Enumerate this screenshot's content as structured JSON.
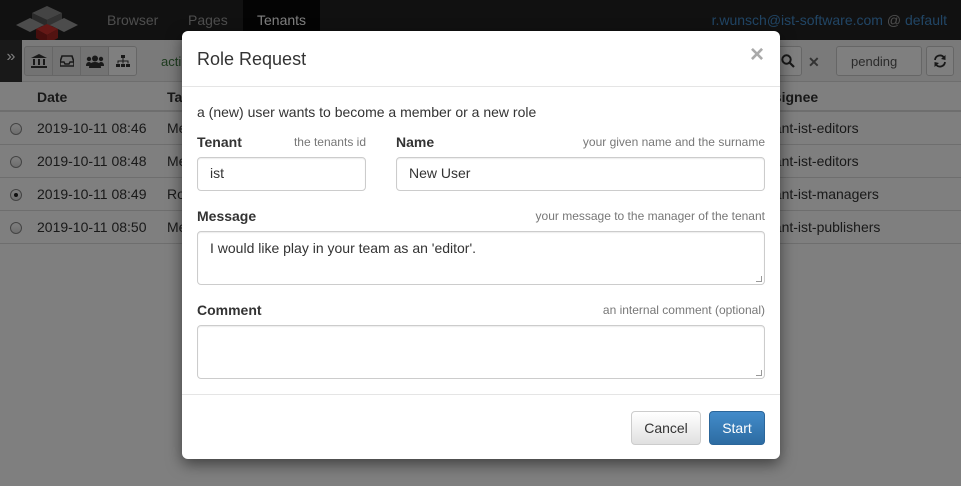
{
  "navbar": {
    "nav_items": [
      "Browser",
      "Pages",
      "Tenants"
    ],
    "active_nav": "Tenants",
    "user_email": "r.wunsch@ist-software.com",
    "at_sign": "@",
    "tenant": "default"
  },
  "toolbar": {
    "filter_label": "acti",
    "status_filter": "pending",
    "icons": [
      "angle-double-right-icon",
      "bank-icon",
      "inbox-icon",
      "users-icon",
      "sitemap-icon",
      "search-icon",
      "close-icon",
      "refresh-icon"
    ]
  },
  "table": {
    "columns": [
      "Date",
      "Ta",
      "ssignee"
    ],
    "rows": [
      {
        "date": "2019-10-11 08:46",
        "type": "Me",
        "assignee": "nant-ist-editors",
        "selected": false
      },
      {
        "date": "2019-10-11 08:48",
        "type": "Me",
        "assignee": "nant-ist-editors",
        "selected": false
      },
      {
        "date": "2019-10-11 08:49",
        "type": "Ro",
        "assignee": "nant-ist-managers",
        "selected": true
      },
      {
        "date": "2019-10-11 08:50",
        "type": "Me",
        "assignee": "nant-ist-publishers",
        "selected": false
      }
    ]
  },
  "modal": {
    "title": "Role Request",
    "close": "×",
    "intro": "a (new) user wants to become a member or a new role",
    "tenant_label": "Tenant",
    "tenant_hint": "the tenants id",
    "tenant_value": "ist",
    "name_label": "Name",
    "name_hint": "your given name and the surname",
    "name_value": "New User",
    "message_label": "Message",
    "message_hint": "your message to the manager of the tenant",
    "message_value": "I would like play in your team as an 'editor'.",
    "comment_label": "Comment",
    "comment_hint": "an internal comment (optional)",
    "comment_value": "",
    "cancel_label": "Cancel",
    "start_label": "Start"
  },
  "colors": {
    "navbar_bg": "#222222",
    "primary": "#428bca",
    "link": "#428bca",
    "filter_text": "#3c763d"
  }
}
